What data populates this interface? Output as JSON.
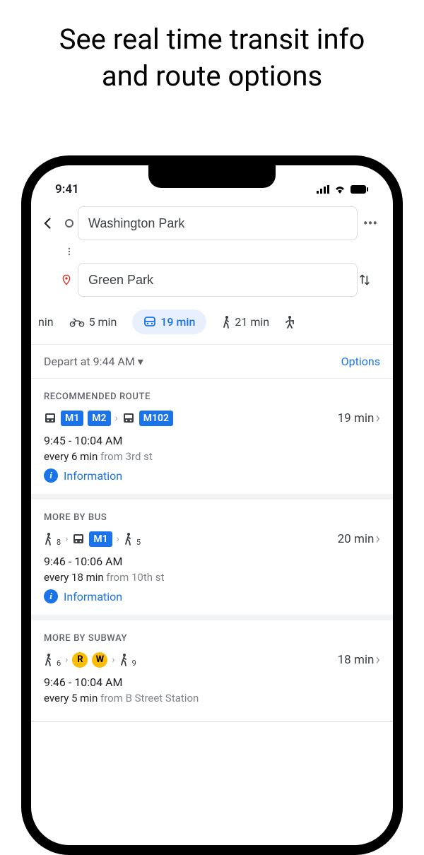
{
  "promo": {
    "line1": "See real time transit info",
    "line2": "and route options"
  },
  "status": {
    "time": "9:41"
  },
  "search": {
    "origin": "Washington Park",
    "destination": "Green Park"
  },
  "modes": {
    "partial": "nin",
    "bike": "5 min",
    "transit": "19 min",
    "walk": "21 min"
  },
  "control": {
    "depart": "Depart at 9:44 AM",
    "options": "Options"
  },
  "sections": {
    "recommended": "RECOMMENDED ROUTE",
    "bus": "MORE BY BUS",
    "subway": "MORE BY SUBWAY"
  },
  "routes": {
    "rec": {
      "lines": {
        "a": "M1",
        "b": "M2",
        "c": "M102"
      },
      "duration": "19 min",
      "time": "9:45 - 10:04 AM",
      "freq": "every 6 min ",
      "from": "from 3rd st",
      "info": "Information"
    },
    "bus": {
      "walk1": "8",
      "walk2": "5",
      "line": "M1",
      "duration": "20 min",
      "time": "9:46 - 10:06 AM",
      "freq": "every 18 min ",
      "from": "from 10th st",
      "info": "Information"
    },
    "subway": {
      "walk1": "6",
      "walk2": "9",
      "lineR": "R",
      "lineW": "W",
      "duration": "18 min",
      "time": "9:46 - 10:04 AM",
      "freq": "every 5 min ",
      "from": "from B Street Station"
    }
  }
}
